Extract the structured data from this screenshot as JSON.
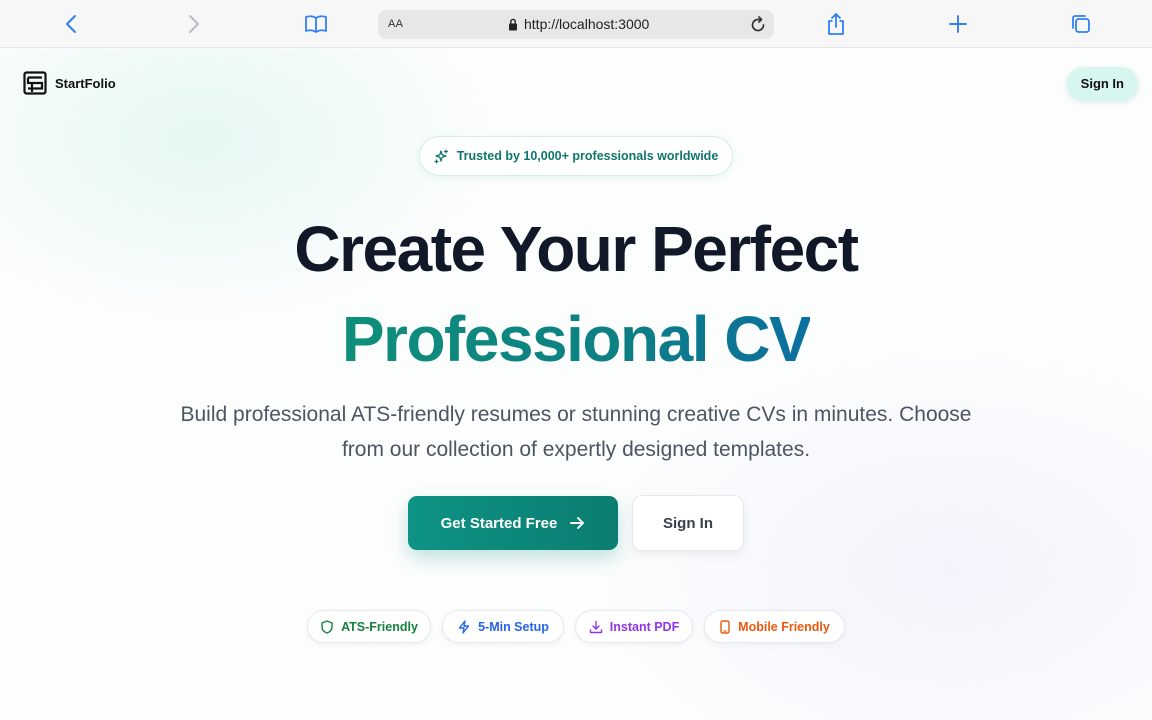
{
  "browser": {
    "text_size_label": "AA",
    "url": "http://localhost:3000"
  },
  "header": {
    "brand_name": "StartFolio",
    "sign_in_label": "Sign In"
  },
  "hero": {
    "badge_text": "Trusted by 10,000+ professionals worldwide",
    "title_line1": "Create Your Perfect",
    "title_line2": "Professional CV",
    "subtitle": "Build professional ATS-friendly resumes or stunning creative CVs in minutes. Choose from our collection of expertly designed templates.",
    "primary_cta": "Get Started Free",
    "secondary_cta": "Sign In"
  },
  "features": [
    {
      "label": "ATS-Friendly",
      "icon": "shield-icon",
      "color": "#15803d"
    },
    {
      "label": "5-Min Setup",
      "icon": "lightning-icon",
      "color": "#2563eb"
    },
    {
      "label": "Instant PDF",
      "icon": "download-icon",
      "color": "#9333ea"
    },
    {
      "label": "Mobile Friendly",
      "icon": "mobile-icon",
      "color": "#ea580c"
    }
  ],
  "colors": {
    "accent": "#0f766e",
    "accent_light": "#d8f6f0",
    "browser_icon": "#2f7ff5"
  }
}
